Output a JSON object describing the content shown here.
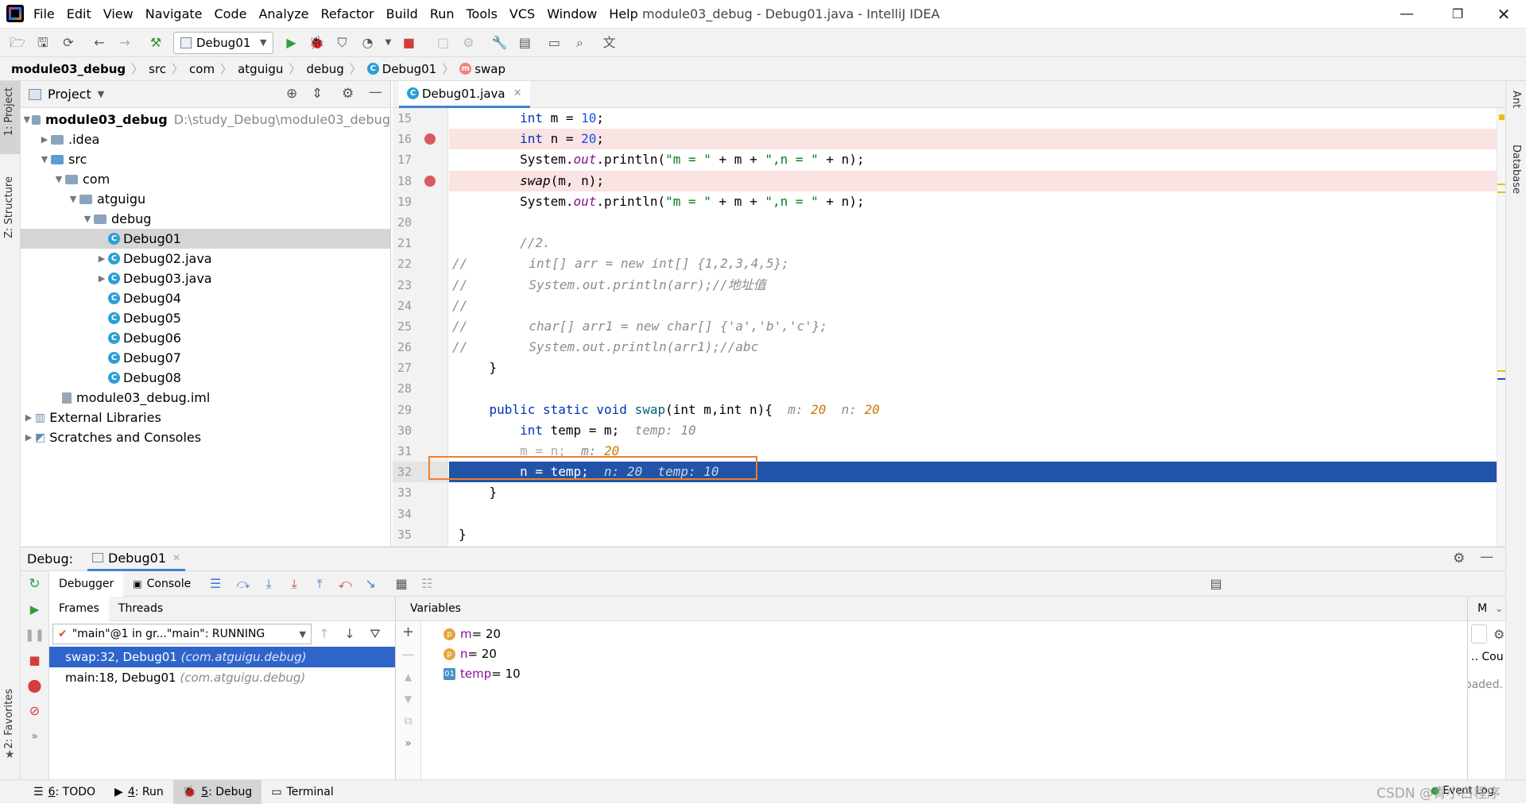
{
  "menu": [
    "File",
    "Edit",
    "View",
    "Navigate",
    "Code",
    "Analyze",
    "Refactor",
    "Build",
    "Run",
    "Tools",
    "VCS",
    "Window",
    "Help"
  ],
  "window_title": "module03_debug - Debug01.java - IntelliJ IDEA",
  "run_config": "Debug01",
  "breadcrumb": [
    "module03_debug",
    "src",
    "com",
    "atguigu",
    "debug",
    "Debug01",
    "swap"
  ],
  "left_strip": {
    "project": "1: Project",
    "structure": "Z: Structure",
    "favorites": "2: Favorites"
  },
  "right_strip": {
    "ant": "Ant",
    "database": "Database"
  },
  "project_panel": {
    "title": "Project",
    "root": "module03_debug",
    "root_path": "D:\\study_Debug\\module03_debug",
    "items": [
      ".idea",
      "src",
      "com",
      "atguigu",
      "debug",
      "Debug01",
      "Debug02.java",
      "Debug03.java",
      "Debug04",
      "Debug05",
      "Debug06",
      "Debug07",
      "Debug08",
      "module03_debug.iml",
      "External Libraries",
      "Scratches and Consoles"
    ]
  },
  "editor": {
    "tab": "Debug01.java",
    "line_numbers": [
      "15",
      "16",
      "17",
      "18",
      "19",
      "20",
      "21",
      "22",
      "23",
      "24",
      "25",
      "26",
      "27",
      "28",
      "29",
      "30",
      "31",
      "32",
      "33",
      "34",
      "35"
    ],
    "code": {
      "l15_type": "int",
      "l15_rest": " m = ",
      "l15_num": "10",
      "l15_end": ";",
      "l16_type": "int",
      "l16_rest": " n = ",
      "l16_num": "20",
      "l16_end": ";",
      "l17_a": "System.",
      "l17_out": "out",
      "l17_b": ".println(",
      "l17_s1": "\"m = \"",
      "l17_c": " + m + ",
      "l17_s2": "\",n = \"",
      "l17_d": " + n);",
      "l18_fn": "swap",
      "l18_rest": "(m, n);",
      "l19_a": "System.",
      "l19_out": "out",
      "l19_b": ".println(",
      "l19_s1": "\"m = \"",
      "l19_c": " + m + ",
      "l19_s2": "\",n = \"",
      "l19_d": " + n);",
      "l21": "//2.",
      "l22": "//        int[] arr = new int[] {1,2,3,4,5};",
      "l23": "//        System.out.println(arr);//地址值",
      "l24": "//",
      "l25": "//        char[] arr1 = new char[] {'a','b','c'};",
      "l26": "//        System.out.println(arr1);//abc",
      "l27": "}",
      "l29_kw": "public static void",
      "l29_fn": "swap",
      "l29_rest": "(int m,int n){",
      "l29_h1": "m: ",
      "l29_v1": "20",
      "l29_h2": "n: ",
      "l29_v2": "20",
      "l30_kw": "int",
      "l30_rest": " temp = m;",
      "l30_h": "temp: 10",
      "l31": "m = n;",
      "l31_h": "m: ",
      "l31_v": "20",
      "l32": "n = temp;",
      "l32_h": "n: 20  temp: 10",
      "l33": "}",
      "l35": "}"
    }
  },
  "debug": {
    "label": "Debug:",
    "session": "Debug01",
    "tabs": [
      "Debugger",
      "Console"
    ],
    "frames_tabs": [
      "Frames",
      "Threads"
    ],
    "thread": "\"main\"@1 in gr...\"main\": RUNNING",
    "frames": [
      {
        "method": "swap:32, Debug01",
        "pkg": "(com.atguigu.debug)"
      },
      {
        "method": "main:18, Debug01",
        "pkg": "(com.atguigu.debug)"
      }
    ],
    "variables_title": "Variables",
    "variables": [
      {
        "icon": "p",
        "name": "m",
        "value": " = 20"
      },
      {
        "icon": "p",
        "name": "n",
        "value": " = 20"
      },
      {
        "icon": "01",
        "name": "temp",
        "value": " = 10"
      }
    ],
    "right_frag": {
      "m": "M",
      "cou": "Cou",
      "loaded": "oaded. L"
    }
  },
  "statusbar": {
    "tabs": [
      {
        "num": "6",
        "rest": ": TODO"
      },
      {
        "num": "4",
        "rest": ": Run"
      },
      {
        "num": "5",
        "rest": ": Debug"
      },
      {
        "num": "",
        "rest": "Terminal"
      }
    ],
    "event_log": "Event Log",
    "watermark": "CSDN @青小白程序"
  }
}
